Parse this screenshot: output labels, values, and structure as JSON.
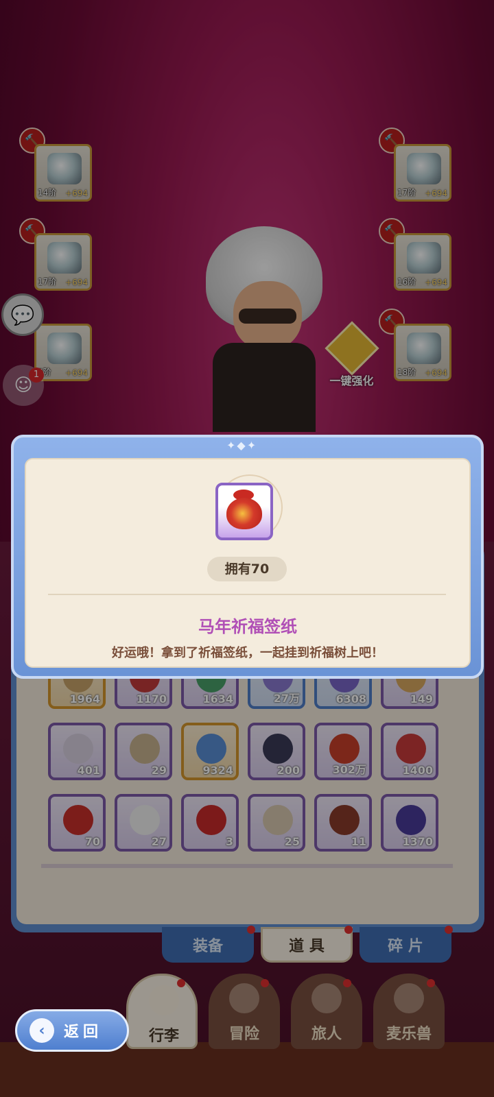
{
  "equipment": [
    {
      "level": "14阶",
      "power": "+694"
    },
    {
      "level": "17阶",
      "power": "+694"
    },
    {
      "level": "5阶",
      "power": "+694"
    },
    {
      "level": "17阶",
      "power": "+694"
    },
    {
      "level": "16阶",
      "power": "+694"
    },
    {
      "level": "18阶",
      "power": "+694"
    }
  ],
  "one_click_strengthen": "一键强化",
  "notification_count": "1",
  "bag_items": [
    {
      "count": "1964",
      "rarity": "gold"
    },
    {
      "count": "1170",
      "rarity": "purple"
    },
    {
      "count": "1634",
      "rarity": "purple"
    },
    {
      "count": "27万",
      "rarity": "blue"
    },
    {
      "count": "6308",
      "rarity": "blue"
    },
    {
      "count": "149",
      "rarity": "purple"
    },
    {
      "count": "401",
      "rarity": "purple"
    },
    {
      "count": "29",
      "rarity": "purple"
    },
    {
      "count": "9324",
      "rarity": "gold"
    },
    {
      "count": "200",
      "rarity": "purple"
    },
    {
      "count": "302万",
      "rarity": "purple"
    },
    {
      "count": "1400",
      "rarity": "purple"
    },
    {
      "count": "70",
      "rarity": "purple"
    },
    {
      "count": "27",
      "rarity": "purple"
    },
    {
      "count": "3",
      "rarity": "purple"
    },
    {
      "count": "25",
      "rarity": "purple"
    },
    {
      "count": "11",
      "rarity": "purple"
    },
    {
      "count": "1370",
      "rarity": "purple"
    }
  ],
  "tabs": [
    {
      "label": "装备"
    },
    {
      "label": "道 具"
    },
    {
      "label": "碎 片"
    }
  ],
  "nav": [
    {
      "label": "行李"
    },
    {
      "label": "冒险"
    },
    {
      "label": "旅人"
    },
    {
      "label": "麦乐兽"
    }
  ],
  "back_label": "返回",
  "modal": {
    "owned": "拥有70",
    "title": "马年祈福签纸",
    "description": "好运哦！拿到了祈福签纸，一起挂到祈福树上吧！"
  },
  "colors": {
    "accent": "#b04fb6",
    "panel_blue": "#6a93d6",
    "parchment": "#f4ecdd"
  }
}
